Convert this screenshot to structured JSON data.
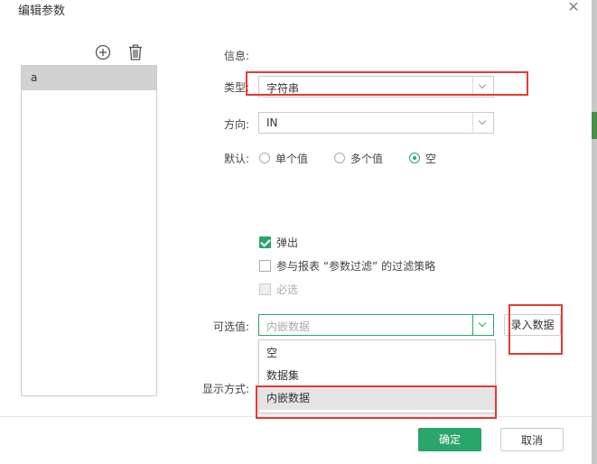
{
  "dialog": {
    "title": "编辑参数"
  },
  "params_list": {
    "items": [
      {
        "label": "a"
      }
    ]
  },
  "form": {
    "info_label": "信息:",
    "type_label": "类型:",
    "type_value": "字符串",
    "direction_label": "方向:",
    "direction_value": "IN",
    "default_label": "默认:",
    "default_options": [
      "单个值",
      "多个值",
      "空"
    ],
    "default_selected": "空",
    "checkbox_popup": "弹出",
    "checkbox_filter": "参与报表 “参数过滤” 的过滤策略",
    "checkbox_required": "必选",
    "optional_label": "可选值:",
    "optional_placeholder": "内嵌数据",
    "optional_options": [
      "空",
      "数据集",
      "内嵌数据"
    ],
    "optional_selected": "内嵌数据",
    "enter_data_button": "录入数据",
    "display_label": "显示方式:"
  },
  "footer": {
    "ok": "确定",
    "cancel": "取消"
  },
  "colors": {
    "accent": "#2aa56b",
    "highlight": "#e53935"
  }
}
